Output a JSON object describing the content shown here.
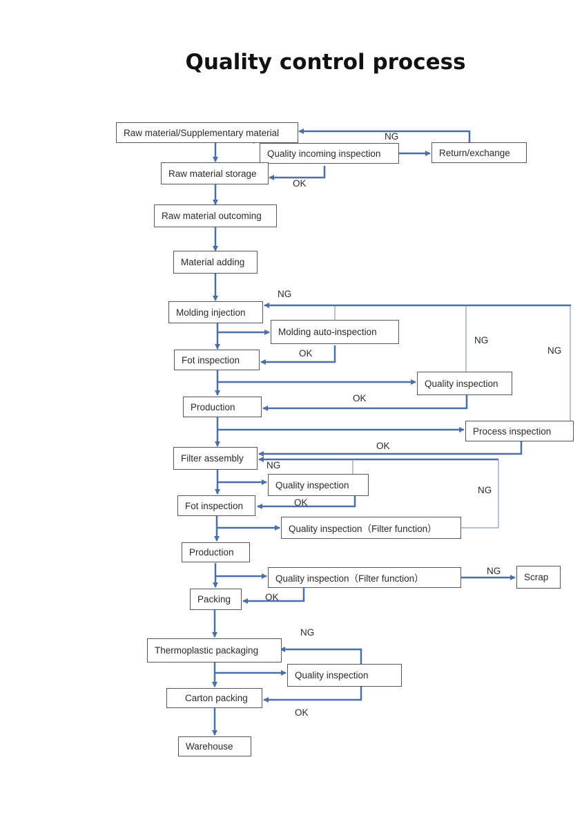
{
  "title": "Quality control process",
  "colors": {
    "flow_line": "#4a6fa8",
    "feedback_line": "#8a9bb5",
    "box_border": "#555555"
  },
  "nodes": {
    "raw_material": "Raw material/Supplementary material",
    "incoming_inspection": "Quality incoming  inspection",
    "return_exchange": "Return/exchange",
    "raw_storage": "Raw material storage",
    "raw_outcoming": "Raw material outcoming",
    "material_adding": "Material adding",
    "molding_injection": "Molding injection",
    "molding_auto_inspection": "Molding auto-inspection",
    "fot_inspection_1": "Fot inspection",
    "quality_inspection_1": "Quality inspection",
    "production_1": "Production",
    "process_inspection": "Process inspection",
    "filter_assembly": "Filter assembly",
    "quality_inspection_2": "Quality inspection",
    "fot_inspection_2": "Fot inspection",
    "quality_filter_function_1": "Quality inspection（Filter function）",
    "production_2": "Production",
    "quality_filter_function_2": "Quality inspection（Filter function）",
    "scrap": "Scrap",
    "packing": "Packing",
    "thermoplastic_packaging": "Thermoplastic packaging",
    "quality_inspection_3": "Quality inspection",
    "carton_packing": "Carton packing",
    "warehouse": "Warehouse"
  },
  "labels": {
    "ng": "NG",
    "ok": "OK"
  }
}
